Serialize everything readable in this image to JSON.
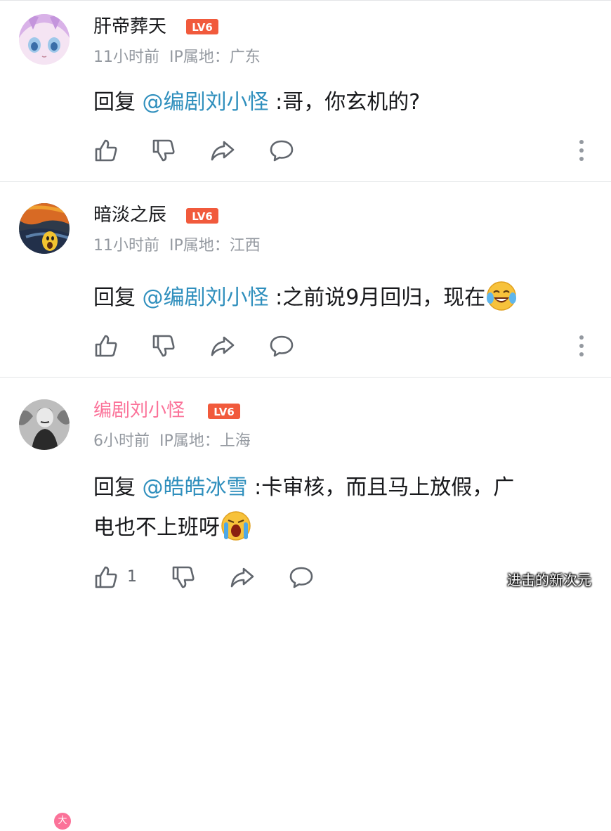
{
  "comments": [
    {
      "username": "肝帝葬天",
      "level": "LV6",
      "time": "11小时前",
      "ip": "IP属地：广东",
      "reply_prefix": "回复 ",
      "mention": "@编剧刘小怪",
      "text": " :哥，你玄机的?",
      "like_count": ""
    },
    {
      "username": "暗淡之辰",
      "level": "LV6",
      "time": "11小时前",
      "ip": "IP属地：江西",
      "reply_prefix": "回复 ",
      "mention": "@编剧刘小怪",
      "text": " :之前说9月回归，现在",
      "like_count": ""
    },
    {
      "username": "编剧刘小怪",
      "level": "LV6",
      "time": "6小时前",
      "ip": "IP属地：上海",
      "reply_prefix": "回复 ",
      "mention": "@皓皓冰雪",
      "text": " :卡审核，而且马上放假，广",
      "text_line2": "电也不上班呀",
      "like_count": "1",
      "avatar_badge": "大"
    }
  ],
  "icons": [
    "like-icon",
    "dislike-icon",
    "share-icon",
    "reply-icon",
    "more-icon",
    "laugh-cry-emoji",
    "crying-emoji"
  ],
  "colors": {
    "mention": "#2f8fbd",
    "up_name": "#fb7299",
    "level_badge": "#f15a3c",
    "meta": "#9499a0"
  },
  "watermark": "进击的新次元"
}
